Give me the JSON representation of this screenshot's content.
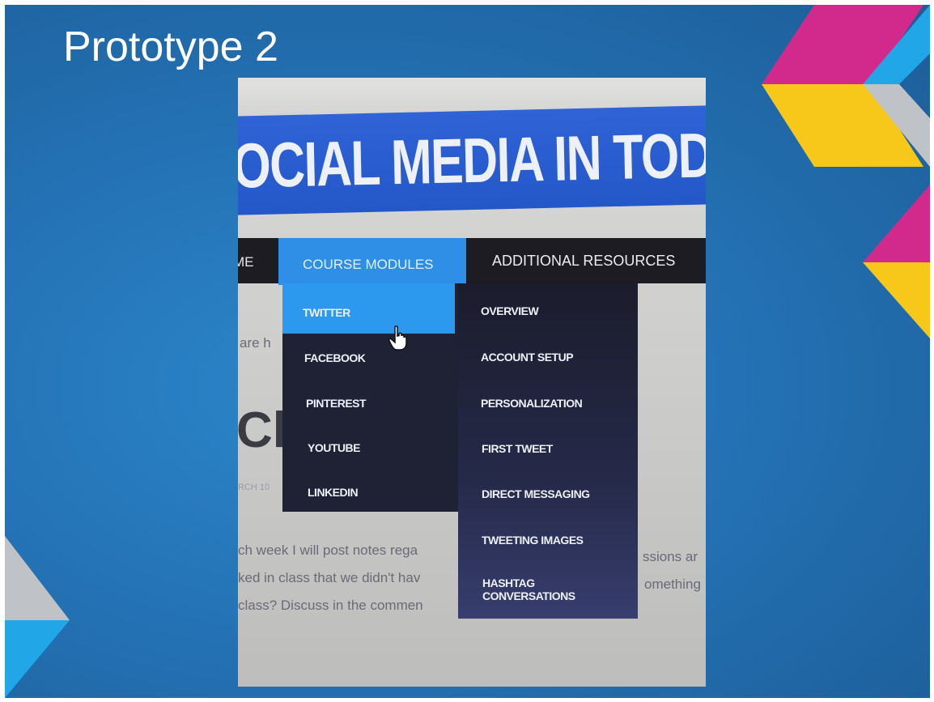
{
  "slide": {
    "title": "Prototype 2",
    "colors": {
      "background": "#2473b6",
      "magenta": "#d12a8c",
      "yellow": "#f7c81a",
      "cyan": "#21a6e8",
      "grey": "#bfc3c7"
    }
  },
  "photo": {
    "banner_text": "OCIAL MEDIA IN TODAY",
    "nav": {
      "home_label": "ME",
      "course_modules_label": "COURSE MODULES",
      "additional_resources_label": "ADDITIONAL RESOURCES"
    },
    "course_menu": [
      "TWITTER",
      "FACEBOOK",
      "PINTEREST",
      "YOUTUBE",
      "LINKEDIN"
    ],
    "twitter_menu": [
      "OVERVIEW",
      "ACCOUNT SETUP",
      "PERSONALIZATION",
      "FIRST TWEET",
      "DIRECT MESSAGING",
      "TWEETING IMAGES",
      "HASHTAG",
      "CONVERSATIONS"
    ],
    "page": {
      "fragment_1": "are h",
      "heading_fragment": "Cla",
      "date_fragment": "RCH 10",
      "body_lines": [
        "ch week I will post notes rega",
        "ked in class that we didn't hav",
        "class? Discuss in the commen"
      ],
      "right_fragments": [
        "ssions ar",
        "omething"
      ]
    }
  }
}
